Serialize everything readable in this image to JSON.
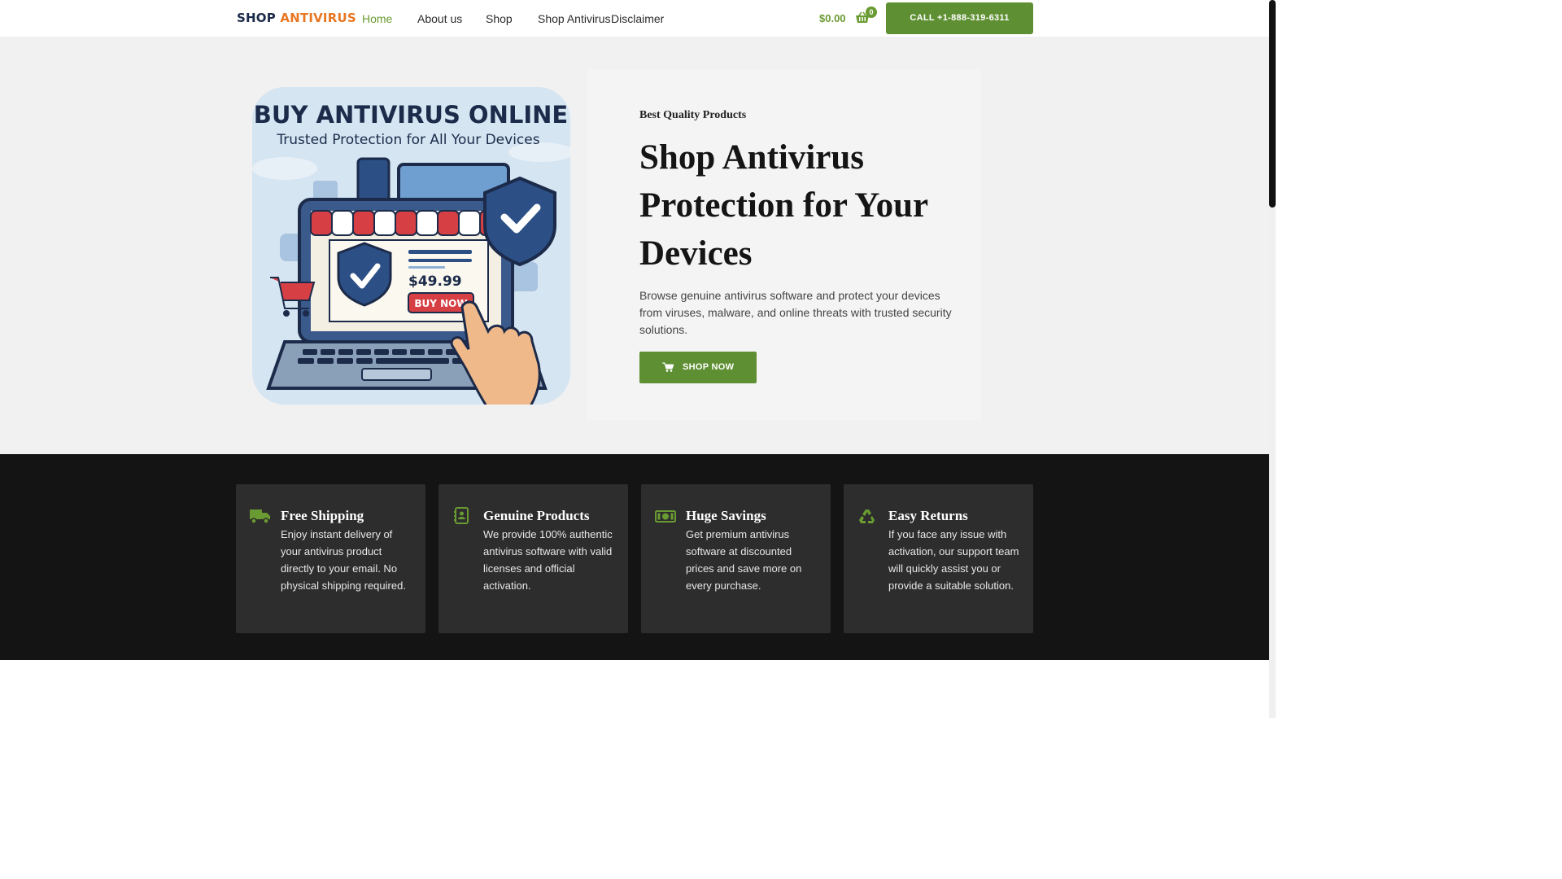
{
  "header": {
    "logo_part1": "SHOP",
    "logo_part2": "ANTIVIRUS",
    "nav": [
      "Home",
      "About us",
      "Shop",
      "Shop Antivirus",
      "Disclaimer"
    ],
    "active_nav": "Home",
    "cart_total": "$0.00",
    "cart_count": "0",
    "call_label": "CALL +1-888-319-6311"
  },
  "hero": {
    "image": {
      "headline": "BUY ANTIVIRUS ONLINE",
      "subheadline": "Trusted Protection for All Your Devices",
      "price": "$49.99",
      "buy_label": "BUY NOW"
    },
    "eyebrow": "Best Quality Products",
    "title": "Shop Antivirus Protection for Your Devices",
    "description": "Browse genuine antivirus software and protect your devices from viruses, malware, and online threats with trusted security solutions.",
    "button_label": "SHOP NOW"
  },
  "features": [
    {
      "icon": "truck-icon",
      "title": "Free Shipping",
      "text": "Enjoy instant delivery of your antivirus product directly to your email. No physical shipping required."
    },
    {
      "icon": "contact-card-icon",
      "title": "Genuine Products",
      "text": "We provide 100% authentic antivirus software with valid licenses and official activation."
    },
    {
      "icon": "money-bill-icon",
      "title": "Huge Savings",
      "text": "Get premium antivirus software at discounted prices and save more on every purchase."
    },
    {
      "icon": "recycle-icon",
      "title": "Easy Returns",
      "text": "If you face any issue with activation, our support team will quickly assist you or provide a suitable solution."
    }
  ],
  "colors": {
    "accent_green": "#5e8f32",
    "logo_navy": "#1c2b4a",
    "logo_orange": "#e87722",
    "feature_band": "#141414",
    "feature_card": "#2d2d2d"
  }
}
